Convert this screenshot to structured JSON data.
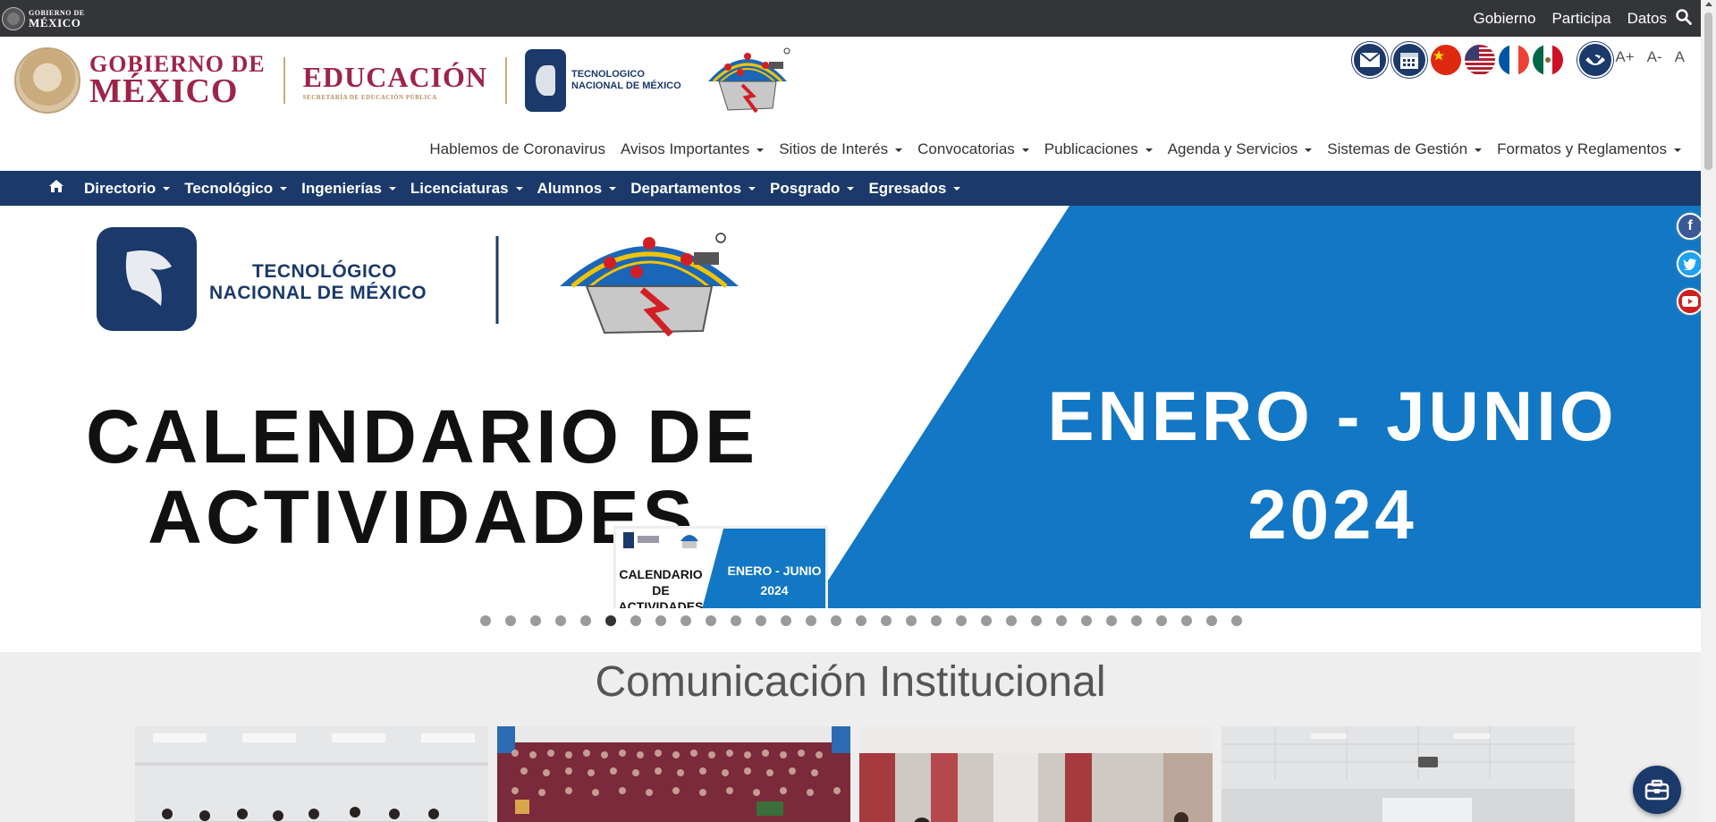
{
  "gov_bar": {
    "logo_line1": "GOBIERNO DE",
    "logo_line2": "MÉXICO",
    "links": [
      "Gobierno",
      "Participa",
      "Datos"
    ]
  },
  "header": {
    "gov_line1": "GOBIERNO DE",
    "gov_line2": "MÉXICO",
    "edu_title": "EDUCACIÓN",
    "edu_subtitle": "SECRETARÍA DE EDUCACIÓN PÚBLICA",
    "tecnm_line1": "TECNOLOGICO",
    "tecnm_line2": "NACIONAL DE MÉXICO",
    "text_tools": [
      "A+",
      "A-",
      "A"
    ]
  },
  "subnav": [
    {
      "label": "Hablemos de Coronavirus",
      "dropdown": false
    },
    {
      "label": "Avisos Importantes",
      "dropdown": true
    },
    {
      "label": "Sitios de Interés",
      "dropdown": true
    },
    {
      "label": "Convocatorias",
      "dropdown": true
    },
    {
      "label": "Publicaciones",
      "dropdown": true
    },
    {
      "label": "Agenda y Servicios",
      "dropdown": true
    },
    {
      "label": "Sistemas de Gestión",
      "dropdown": true
    },
    {
      "label": "Formatos y Reglamentos",
      "dropdown": true
    }
  ],
  "mainnav": [
    "Directorio",
    "Tecnológico",
    "Ingenierías",
    "Licenciaturas",
    "Alumnos",
    "Departamentos",
    "Posgrado",
    "Egresados"
  ],
  "banner": {
    "tecnm_line1": "TECNOLÓGICO",
    "tecnm_line2": "NACIONAL DE MÉXICO",
    "title_line1": "CALENDARIO DE",
    "title_line2": "ACTIVIDADES",
    "period_line1": "ENERO - JUNIO",
    "period_line2": "2024",
    "thumb_left_line1": "CALENDARIO DE",
    "thumb_left_line2": "ACTIVIDADES",
    "thumb_right_line1": "ENERO - JUNIO",
    "thumb_right_line2": "2024",
    "slide_count": 31,
    "active_slide": 6
  },
  "section": {
    "title": "Comunicación Institucional"
  },
  "colors": {
    "gov_bar": "#333539",
    "navy": "#1b396a",
    "guinda": "#9d2449",
    "banner_blue": "#1277c4",
    "section_bg": "#eeeeee"
  }
}
